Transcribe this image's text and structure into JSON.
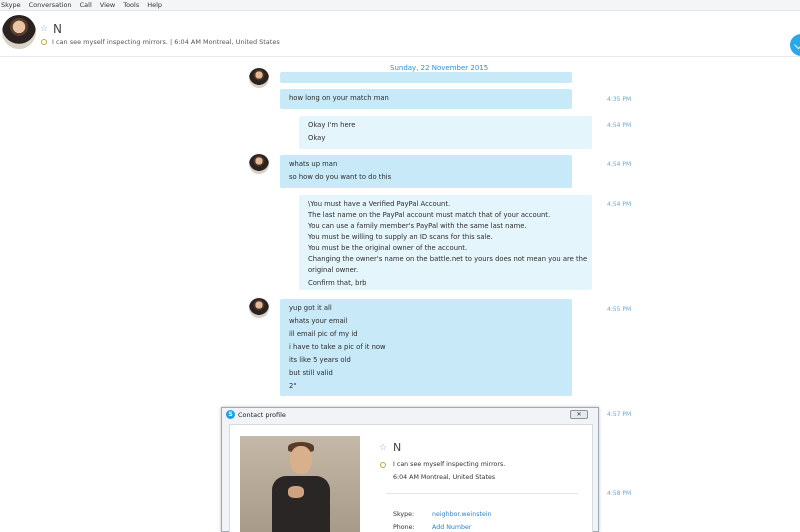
{
  "menu": [
    "Skype",
    "Conversation",
    "Call",
    "View",
    "Tools",
    "Help"
  ],
  "contact": {
    "name": "N",
    "mood": "I can see myself inspecting mirrors.",
    "time_location": "6:04 AM Montreal, United States",
    "status_line": "I can see myself inspecting mirrors.  |  6:04 AM Montreal, United States"
  },
  "chat": {
    "date_separator": "Sunday, 22 November 2015",
    "messages": [
      {
        "lines": [
          "how long on your match man"
        ],
        "time": "4:35 PM"
      },
      {
        "lines": [
          "Okay I'm here",
          "Okay"
        ],
        "time": "4:54 PM"
      },
      {
        "lines": [
          "whats up man",
          "so how do you want to do this"
        ],
        "time": "4:54 PM"
      },
      {
        "lines": [
          "\\You must have a Verified PayPal Account.",
          "The last name on the PayPal account must match that of your account.",
          "You can use a family member's PayPal with the same last name.",
          "You must be willing to supply an ID scans for this sale.",
          "You must be the original owner of the account.",
          "Changing the owner's name on the battle.net to yours does not mean you are the",
          "original owner.",
          "Confirm that, brb"
        ],
        "time": "4:54 PM"
      },
      {
        "lines": [
          "yup got it all",
          "whats your email",
          "ill email pic of my id",
          "i have to take a pic of it now",
          "its like 5 years old",
          "but still valid",
          "2\""
        ],
        "time": "4:55 PM"
      },
      {
        "lines": [],
        "time": "4:57 PM"
      },
      {
        "lines": [],
        "time": "4:58 PM"
      }
    ]
  },
  "contact_profile": {
    "title": "Contact profile",
    "close_label": "✕",
    "name": "N",
    "mood": "I can see myself inspecting mirrors.",
    "location": "6:04 AM Montreal, United States",
    "skype_label": "Skype:",
    "skype_value": "neighbor.weinstein",
    "phone_label": "Phone:",
    "phone_value": "Add Number"
  },
  "colors": {
    "accent": "#2d90d6",
    "bubble_incoming": "#c7e9f8",
    "bubble_outgoing": "#e5f5fc",
    "status_away": "#b7a935"
  }
}
